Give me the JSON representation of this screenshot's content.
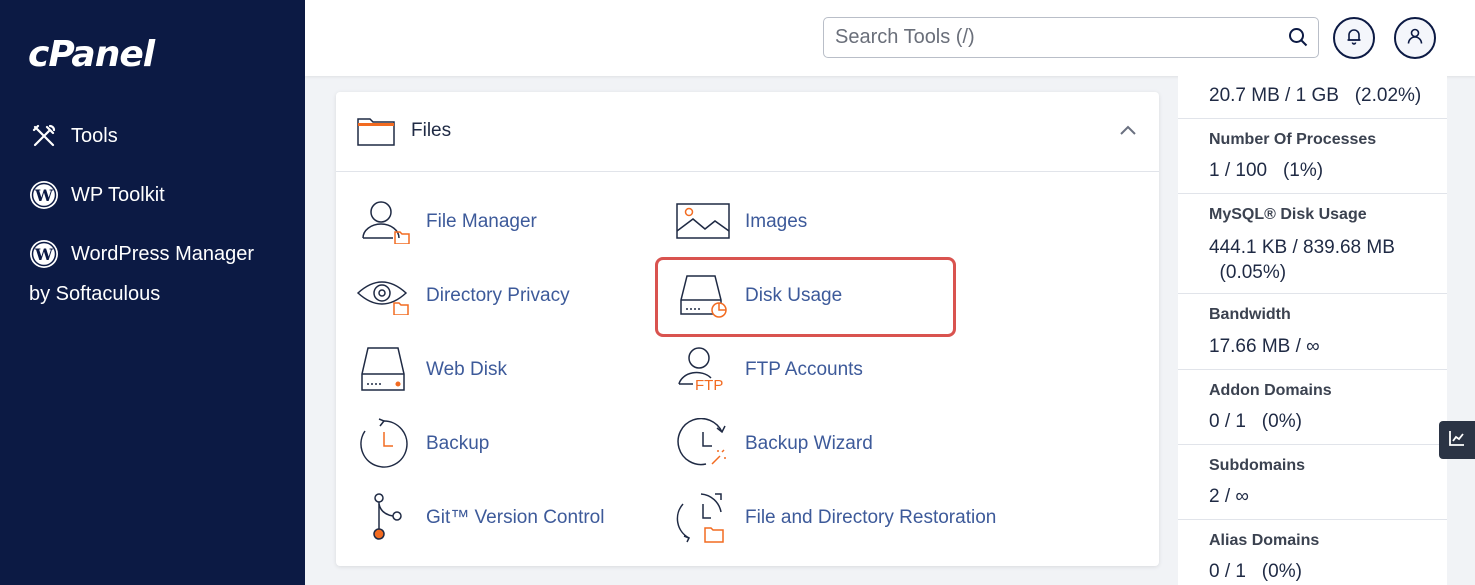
{
  "sidebar": {
    "logo": "cPanel",
    "items": [
      {
        "label": "Tools",
        "icon": "tools-icon"
      },
      {
        "label": "WP Toolkit",
        "icon": "wordpress-icon"
      },
      {
        "label": "WordPress Manager",
        "icon": "wordpress-icon"
      }
    ],
    "wpm_sub": "by Softaculous"
  },
  "header": {
    "search_placeholder": "Search Tools (/)"
  },
  "files": {
    "title": "Files",
    "tools": [
      {
        "label": "File Manager",
        "icon": "file-manager-icon"
      },
      {
        "label": "Images",
        "icon": "images-icon"
      },
      {
        "label": "Directory Privacy",
        "icon": "directory-privacy-icon"
      },
      {
        "label": "Disk Usage",
        "icon": "disk-usage-icon"
      },
      {
        "label": "Web Disk",
        "icon": "web-disk-icon"
      },
      {
        "label": "FTP Accounts",
        "icon": "ftp-accounts-icon"
      },
      {
        "label": "Backup",
        "icon": "backup-icon"
      },
      {
        "label": "Backup Wizard",
        "icon": "backup-wizard-icon"
      },
      {
        "label": "Git™ Version Control",
        "icon": "git-icon"
      },
      {
        "label": "File and Directory Restoration",
        "icon": "restoration-icon"
      }
    ]
  },
  "stats": [
    {
      "label": "",
      "value": "20.7 MB / 1 GB   (2.02%)"
    },
    {
      "label": "Number Of Processes",
      "value": "1 / 100   (1%)"
    },
    {
      "label": "MySQL® Disk Usage",
      "value": "444.1 KB / 839.68 MB\n  (0.05%)"
    },
    {
      "label": "Bandwidth",
      "value": "17.66 MB / ∞"
    },
    {
      "label": "Addon Domains",
      "value": "0 / 1   (0%)"
    },
    {
      "label": "Subdomains",
      "value": "2 / ∞"
    },
    {
      "label": "Alias Domains",
      "value": "0 / 1   (0%)"
    }
  ],
  "colors": {
    "sidebar": "#0c1a44",
    "accent": "#f26b21",
    "link": "#3d5a9a",
    "highlight": "#d9534f"
  }
}
